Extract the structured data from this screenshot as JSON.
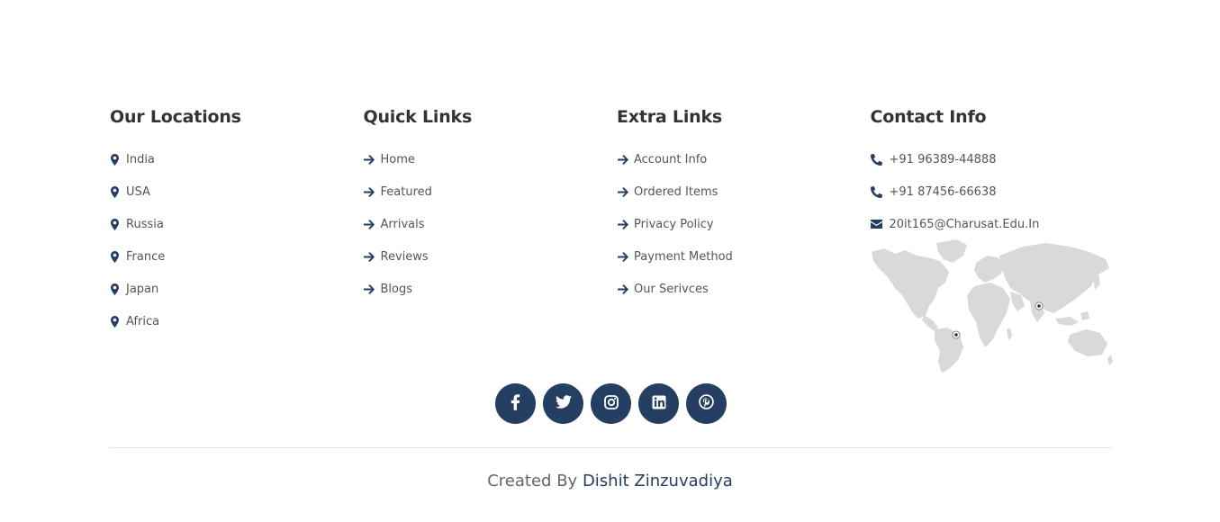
{
  "locations": {
    "title": "Our Locations",
    "items": [
      "India",
      "USA",
      "Russia",
      "France",
      "Japan",
      "Africa"
    ]
  },
  "quick_links": {
    "title": "Quick Links",
    "items": [
      "Home",
      "Featured",
      "Arrivals",
      "Reviews",
      "Blogs"
    ]
  },
  "extra_links": {
    "title": "Extra Links",
    "items": [
      "Account Info",
      "Ordered Items",
      "Privacy Policy",
      "Payment Method",
      "Our Serivces"
    ]
  },
  "contact": {
    "title": "Contact Info",
    "phone_1": "+91 96389-44888",
    "phone_2": "+91 87456-66638",
    "email": "20it165@Charusat.Edu.In"
  },
  "socials": [
    "facebook-icon",
    "twitter-icon",
    "instagram-icon",
    "linkedin-icon",
    "pinterest-icon"
  ],
  "credit": {
    "prefix": "Created By",
    "author": "Dishit Zinzuvadiya"
  },
  "colors": {
    "accent": "#243f61",
    "heading": "#333333",
    "text": "#555555",
    "map": "#d9d9d9"
  }
}
